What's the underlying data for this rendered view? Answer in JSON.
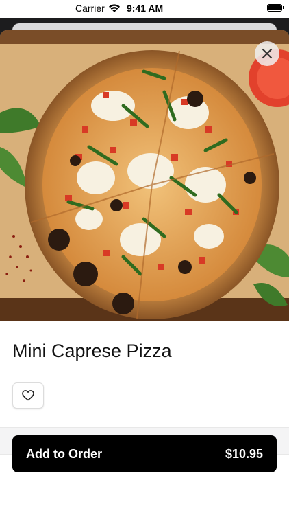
{
  "status_bar": {
    "carrier": "Carrier",
    "time": "9:41 AM",
    "icons": [
      "wifi-icon",
      "battery-icon"
    ]
  },
  "product": {
    "name": "Mini Caprese Pizza",
    "image": "pizza-photo"
  },
  "actions": {
    "close_icon": "close-icon",
    "favorite_icon": "heart-icon",
    "add_label": "Add to Order",
    "price": "$10.95"
  },
  "colors": {
    "button_bg": "#000000",
    "button_text": "#ffffff",
    "title_text": "#111111"
  }
}
